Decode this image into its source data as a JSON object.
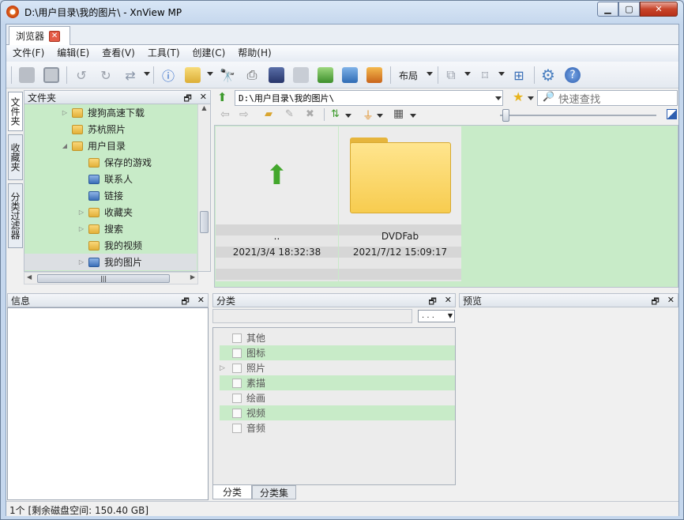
{
  "window": {
    "title": "D:\\用户目录\\我的图片\\ - XnView MP"
  },
  "tabs": [
    {
      "label": "浏览器"
    }
  ],
  "menu": [
    "文件(F)",
    "编辑(E)",
    "查看(V)",
    "工具(T)",
    "创建(C)",
    "帮助(H)"
  ],
  "toolbar": {
    "layout_label": "布局"
  },
  "side_tabs": [
    "文件夹",
    "收藏夹",
    "分类过滤器"
  ],
  "folders_panel": {
    "title": "文件夹",
    "items": [
      {
        "label": "搜狗高速下载",
        "expander": "▷"
      },
      {
        "label": "苏杭照片",
        "expander": ""
      },
      {
        "label": "用户目录",
        "expander": "◢"
      },
      {
        "label": "保存的游戏",
        "expander": ""
      },
      {
        "label": "联系人",
        "expander": ""
      },
      {
        "label": "链接",
        "expander": ""
      },
      {
        "label": "收藏夹",
        "expander": "▷"
      },
      {
        "label": "搜索",
        "expander": "▷"
      },
      {
        "label": "我的视频",
        "expander": ""
      },
      {
        "label": "我的图片",
        "expander": "▷"
      }
    ]
  },
  "path": {
    "value": "D:\\用户目录\\我的图片\\",
    "search_placeholder": "快速查找"
  },
  "thumbnails": [
    {
      "name": "..",
      "date": "2021/3/4 18:32:38"
    },
    {
      "name": "DVDFab",
      "date": "2021/7/12 15:09:17"
    }
  ],
  "info_panel": {
    "title": "信息"
  },
  "category_panel": {
    "title": "分类",
    "dropdown": ". . .",
    "items": [
      {
        "label": "其他",
        "highlight": false,
        "expander": ""
      },
      {
        "label": "图标",
        "highlight": true,
        "expander": ""
      },
      {
        "label": "照片",
        "highlight": false,
        "expander": "▷"
      },
      {
        "label": "素描",
        "highlight": true,
        "expander": ""
      },
      {
        "label": "绘画",
        "highlight": false,
        "expander": ""
      },
      {
        "label": "视频",
        "highlight": true,
        "expander": ""
      },
      {
        "label": "音频",
        "highlight": false,
        "expander": ""
      }
    ],
    "tabs": [
      "分类",
      "分类集"
    ]
  },
  "preview_panel": {
    "title": "预览"
  },
  "statusbar": {
    "text": "1个 [剩余磁盘空间: 150.40 GB]"
  },
  "colors": {
    "selection_green": "#c8ebc8",
    "close_red": "#c7442a"
  }
}
